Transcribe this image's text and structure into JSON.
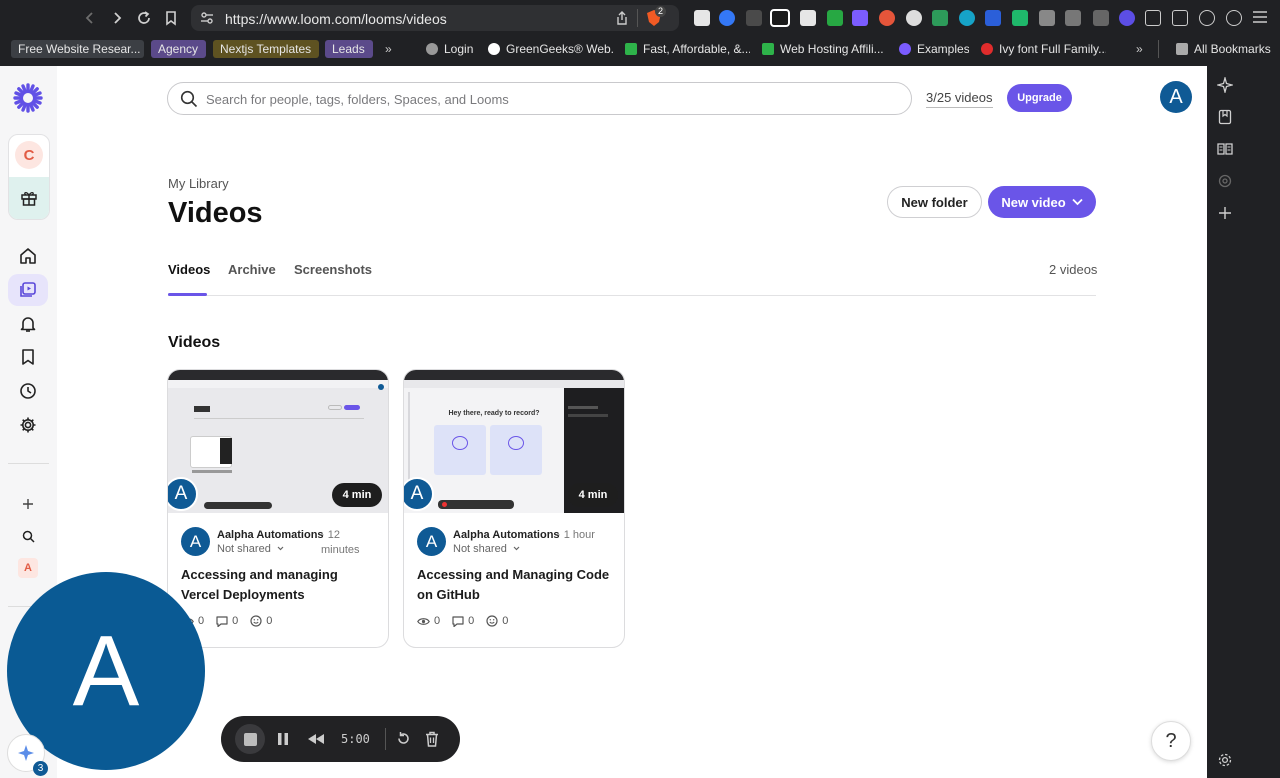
{
  "browser": {
    "url": "https://www.loom.com/looms/videos",
    "notification_count": "2",
    "bookmarks": [
      {
        "label": "Free Website Resear...",
        "color": "#3c3f44"
      },
      {
        "label": "Agency",
        "color": "#5b4a8a"
      },
      {
        "label": "Nextjs Templates",
        "color": "#5e5221"
      },
      {
        "label": "Leads",
        "color": "#5b4a8a"
      },
      {
        "label": "Login"
      },
      {
        "label": "GreenGeeks® Web..."
      },
      {
        "label": "Fast, Affordable, &..."
      },
      {
        "label": "Web Hosting Affili..."
      },
      {
        "label": "Examples"
      },
      {
        "label": "Ivy font Full Family..."
      }
    ],
    "all_bookmarks": "All Bookmarks"
  },
  "sidebar": {
    "workspace_letter": "C",
    "user_letter": "A"
  },
  "header": {
    "search_placeholder": "Search for people, tags, folders, Spaces, and Looms",
    "video_count": "3/25 videos",
    "upgrade": "Upgrade",
    "avatar_letter": "A"
  },
  "page": {
    "breadcrumb": "My Library",
    "title": "Videos",
    "new_folder": "New folder",
    "new_video": "New video",
    "tabs": [
      "Videos",
      "Archive",
      "Screenshots"
    ],
    "total": "2 videos",
    "section": "Videos"
  },
  "videos": [
    {
      "duration": "4 min",
      "author": "Aalpha Automations",
      "time": "· 12 minutes",
      "shared": "Not shared",
      "title": "Accessing and managing Vercel Deployments",
      "views": "0",
      "comments": "0",
      "reactions": "0"
    },
    {
      "duration": "4 min",
      "author": "Aalpha Automations",
      "time": "· 1 hour",
      "shared": "Not shared",
      "title": "Accessing and Managing Code on GitHub",
      "views": "0",
      "comments": "0",
      "reactions": "0",
      "thumb_text": "Hey there, ready to record?"
    }
  ],
  "recorder": {
    "timer": "5:00",
    "camera_letter": "A"
  },
  "misc": {
    "help": "?",
    "badge": "3"
  }
}
